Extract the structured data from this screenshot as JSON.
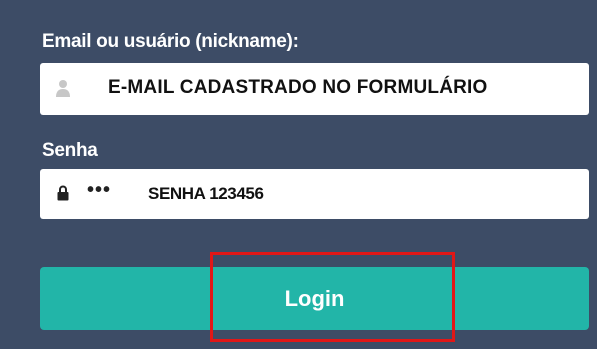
{
  "login_form": {
    "email": {
      "label": "Email ou usuário (nickname):",
      "value": "E-MAIL CADASTRADO NO FORMULÁRIO",
      "icon": "user-icon"
    },
    "password": {
      "label": "Senha",
      "mask": "•••",
      "value": "SENHA 123456",
      "icon": "lock-icon"
    },
    "login_button": {
      "label": "Login"
    }
  },
  "colors": {
    "panel_background": "#3d4c66",
    "button": "#22b5a8",
    "highlight": "#e11717"
  }
}
